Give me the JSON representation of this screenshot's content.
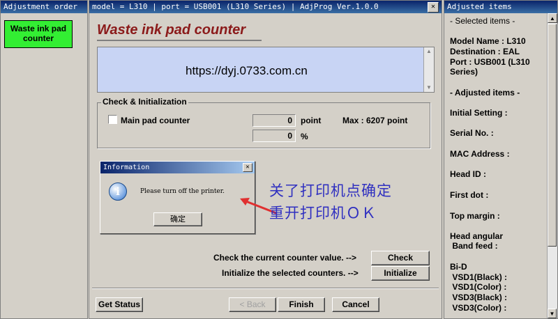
{
  "left": {
    "title": "Adjustment order",
    "items": [
      {
        "label": "Waste ink pad counter"
      }
    ]
  },
  "main": {
    "title_bar": "model = L310 | port = USB001 (L310 Series) | AdjProg Ver.1.0.0",
    "heading": "Waste ink pad counter",
    "banner_text": "https://dyj.0733.com.cn",
    "group_title": "Check & Initialization",
    "main_pad_label": "Main pad counter",
    "counter_value": "0",
    "counter_unit": "point",
    "max_text": "Max : 6207 point",
    "percent_value": "0",
    "percent_unit": "%",
    "check_text": "Check the current counter value.  -->",
    "check_button": "Check",
    "init_text": "Initialize the selected counters.  -->",
    "init_button": "Initialize",
    "get_status_button": "Get Status",
    "back_button": "< Back",
    "finish_button": "Finish",
    "cancel_button": "Cancel"
  },
  "dialog": {
    "title": "Information",
    "message": "Please turn off the printer.",
    "ok_button": "确定"
  },
  "annotation": {
    "line1": "关了打印机点确定",
    "line2": "重开打印机ＯＫ",
    "color": "#3030c0",
    "arrow_color": "#e03030"
  },
  "right": {
    "title": "Adjusted items",
    "selected_header": "- Selected items -",
    "model": "Model Name : L310",
    "destination": "Destination : EAL",
    "port": "Port : USB001 (L310",
    "port2": "Series)",
    "adjusted_header": "- Adjusted items -",
    "items": [
      "Initial Setting :",
      "Serial No. :",
      "MAC Address :",
      "Head ID :",
      "First dot :",
      "Top margin :"
    ],
    "head_angular": "Head angular",
    "band_feed": " Band feed :",
    "bid": "Bi-D",
    "vsd": [
      " VSD1(Black) :",
      " VSD1(Color) :",
      " VSD3(Black) :",
      " VSD3(Color) :"
    ]
  }
}
